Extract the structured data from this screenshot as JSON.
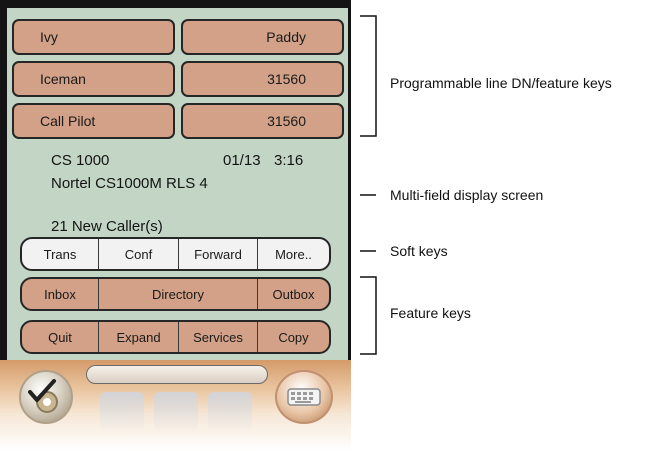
{
  "line_keys": [
    {
      "left": "Ivy",
      "right": "Paddy"
    },
    {
      "left": "Iceman",
      "right": "31560"
    },
    {
      "left": "Call Pilot",
      "right": "31560"
    }
  ],
  "display": {
    "line1": "CS 1000",
    "date": "01/13",
    "time": "3:16",
    "line2": "Nortel CS1000M RLS 4",
    "line3": "21 New Caller(s)"
  },
  "soft_keys": [
    "Trans",
    "Conf",
    "Forward",
    "More.."
  ],
  "feature_row1": [
    "Inbox",
    "Directory",
    "Outbox"
  ],
  "feature_row2": [
    "Quit",
    "Expand",
    "Services",
    "Copy"
  ],
  "annotations": {
    "line_keys": "Programmable line DN/feature keys",
    "display": "Multi-field display screen",
    "soft_keys": "Soft keys",
    "feature_keys": "Feature keys"
  },
  "icons": {
    "left_orb": "settings-check-icon",
    "right_orb": "keyboard-icon"
  }
}
